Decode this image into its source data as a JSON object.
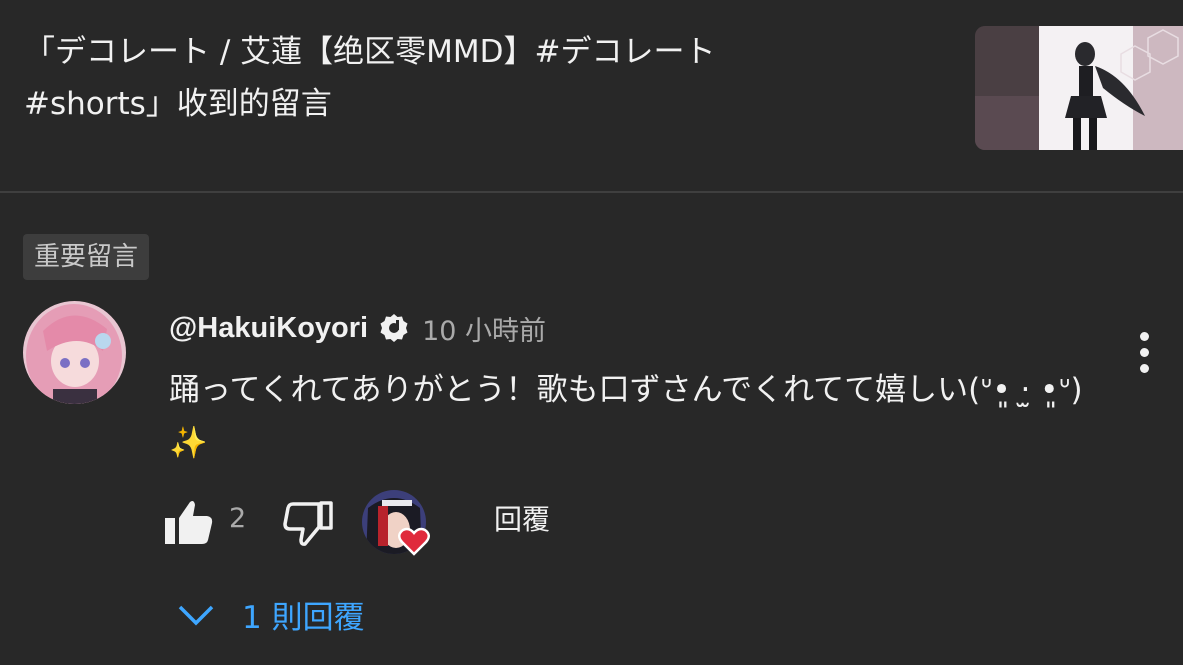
{
  "header": {
    "title": "「デコレート / 艾蓮【绝区零MMD】#デコレート #shorts」收到的留言"
  },
  "pinned_badge": "重要留言",
  "comment": {
    "author": "@HakuiKoyori",
    "time": "10 小時前",
    "text": "踊ってくれてありがとう！歌も口ずさんでくれてて嬉しい(ᐡ•͈ ·̫ •͈ᐡ) ✨",
    "likes": "2",
    "reply_label": "回覆",
    "view_replies": "1 則回覆"
  },
  "icons": {
    "verified": "verified-check-icon",
    "like": "thumbs-up-icon",
    "dislike": "thumbs-down-icon",
    "more": "more-vert-icon",
    "expand": "chevron-down-icon",
    "heart": "heart-icon"
  },
  "colors": {
    "background": "#282828",
    "link": "#3ea6ff",
    "heart": "#e02a3c"
  }
}
